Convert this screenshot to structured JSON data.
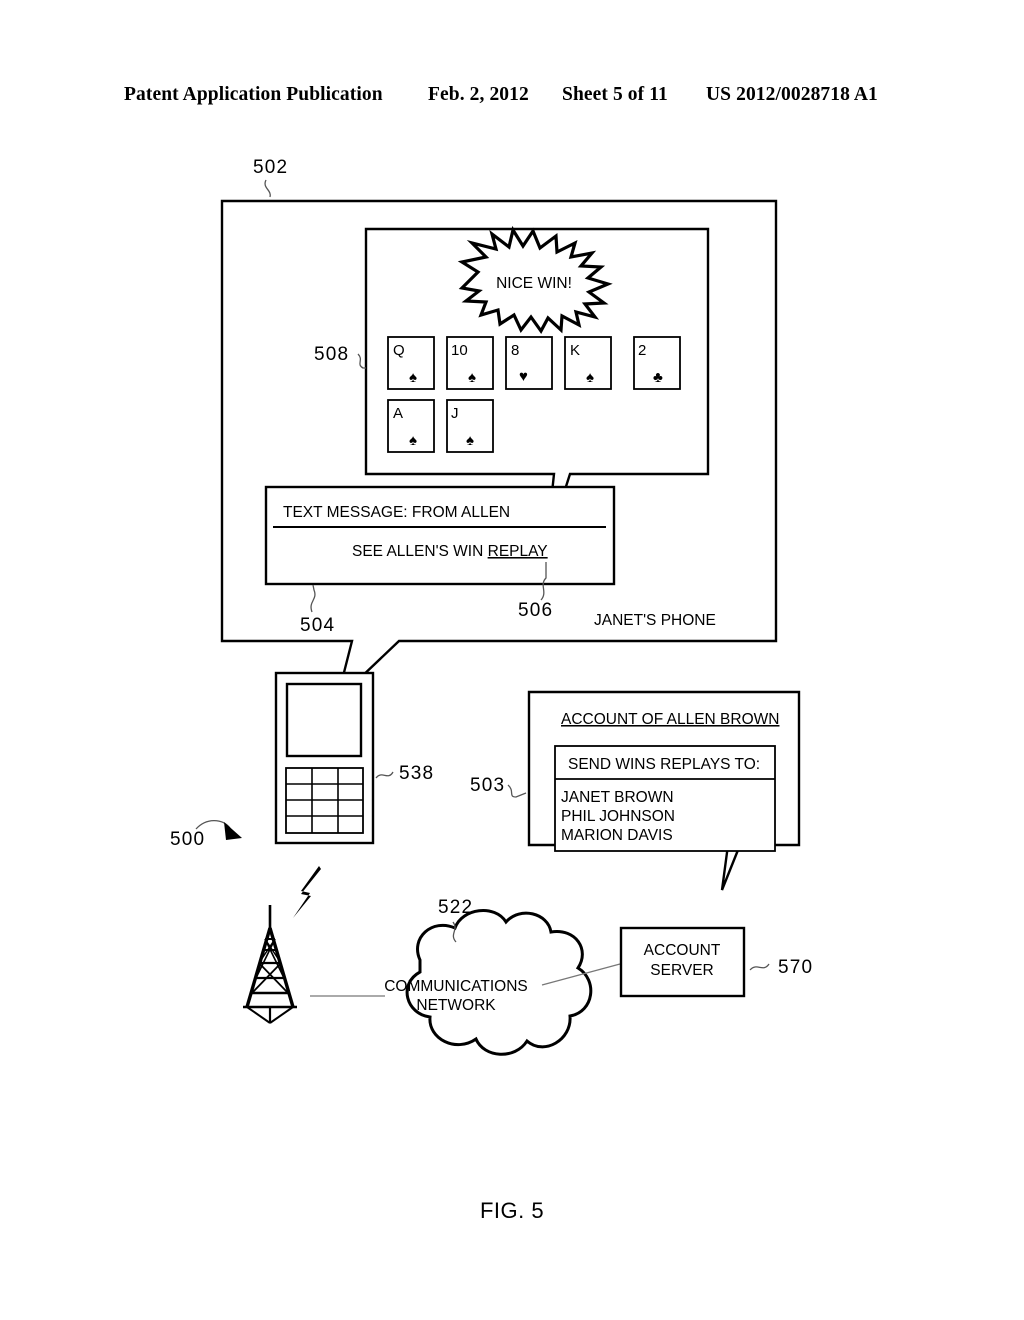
{
  "header": {
    "title": "Patent Application Publication",
    "date": "Feb. 2, 2012",
    "sheet": "Sheet 5 of 11",
    "publication_number": "US 2012/0028718 A1"
  },
  "figure": {
    "caption": "FIG. 5",
    "diagram_reference": "500"
  },
  "phone_display": {
    "outer_label": "JANET'S PHONE",
    "outer_ref": "502",
    "game_screen_ref": "508",
    "message_panel_ref": "504",
    "replay_link_ref": "506",
    "burst_text": "NICE WIN!",
    "message_header": "TEXT MESSAGE: FROM ALLEN",
    "message_body_prefix": "SEE ALLEN'S WIN ",
    "message_body_link": "REPLAY",
    "cards_row1": [
      {
        "rank": "Q",
        "suit": "spade"
      },
      {
        "rank": "10",
        "suit": "spade"
      },
      {
        "rank": "8",
        "suit": "heart"
      },
      {
        "rank": "K",
        "suit": "spade"
      },
      {
        "rank": "2",
        "suit": "club"
      }
    ],
    "cards_row2": [
      {
        "rank": "A",
        "suit": "spade"
      },
      {
        "rank": "J",
        "suit": "spade"
      }
    ]
  },
  "handset": {
    "ref": "538"
  },
  "account_panel": {
    "ref": "503",
    "title": "ACCOUNT OF ALLEN BROWN",
    "list_header": "SEND WINS REPLAYS TO:",
    "recipients": [
      "JANET BROWN",
      "PHIL JOHNSON",
      "MARION DAVIS"
    ]
  },
  "network": {
    "cloud_ref": "522",
    "cloud_line1": "COMMUNICATIONS",
    "cloud_line2": "NETWORK"
  },
  "server": {
    "ref": "570",
    "line1": "ACCOUNT",
    "line2": "SERVER"
  },
  "glyphs": {
    "spade": "♠",
    "heart": "♥",
    "club": "♣"
  }
}
